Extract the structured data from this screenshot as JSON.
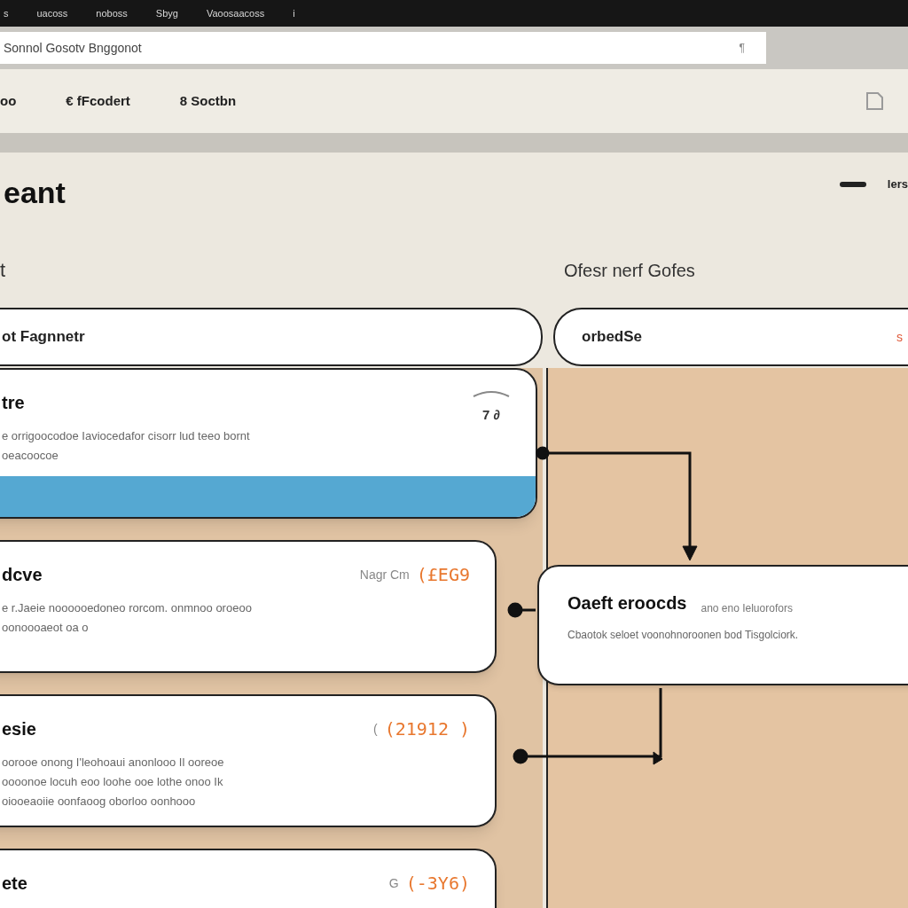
{
  "menu_bar": {
    "items": [
      "s",
      "uacoss",
      "noboss",
      "Sbyg",
      "Vaoosaacoss",
      "i"
    ]
  },
  "address_bar": {
    "value": "Sonnol Gosotv Bnggonot",
    "trailing": "¶"
  },
  "toolbar": {
    "items": [
      "oo",
      "€ fFcodert",
      "8 Soctbn"
    ]
  },
  "page": {
    "title": "eant",
    "top_right": "lers"
  },
  "left_panel": {
    "label": "t",
    "header": "ot Fagnnetr",
    "cards": [
      {
        "title": "tre",
        "description": "e orrigoocodoe Iaviocedafor cisorr lud teeo bornt oeacoocoe",
        "badge": {
          "value": "7 ∂",
          "kind": "plain"
        },
        "selected": true
      },
      {
        "title": "dcve",
        "description": "e r.Jaeie noooooedoneo rorcom. onmnoo oroeoo oonoooaeot oa o",
        "badge": {
          "prefix": "Nagr Cm",
          "value": "(£EG9",
          "kind": "accent"
        },
        "selected": false
      },
      {
        "title": "esie",
        "description": "oorooe onong  I'leohoaui anonlooo Il ooreoe oooonoe locuh eoo loohe  ooe lothe onoo Ik oiooeaoiie oonfaoog oborloo oonhooo",
        "badge": {
          "prefix": "(",
          "value": "(21912 )",
          "kind": "accent"
        },
        "selected": false
      },
      {
        "title": "ete",
        "badge": {
          "prefix": "G",
          "value": "(-3Y6)",
          "kind": "accent"
        },
        "selected": false
      }
    ]
  },
  "right_panel": {
    "label": "Ofesr nerf Gofes",
    "header": "orbedSe",
    "header_trailing": "s",
    "node": {
      "title": "Oaeft eroocds",
      "subtitle": "ano eno Ieluorofors",
      "description": "Cbaotok seloet  voonohnoroonen bod Tisgolciork."
    }
  }
}
